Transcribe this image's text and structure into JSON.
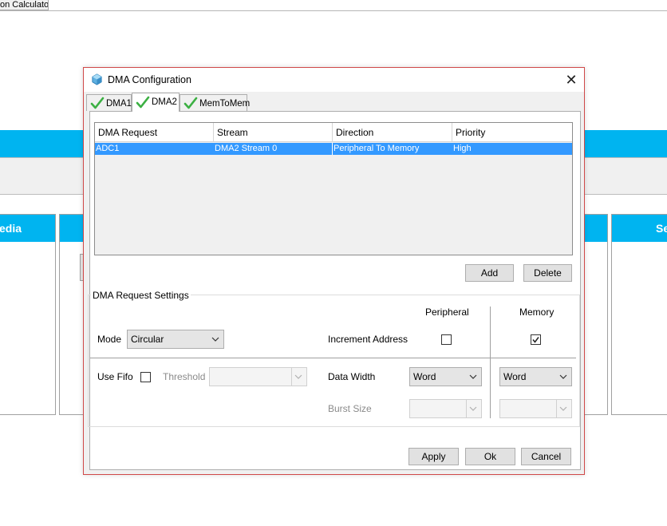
{
  "background": {
    "tab_label": "on Calculator",
    "panel_left_header": "edia",
    "panel_right_header": "Se"
  },
  "dialog": {
    "title": "DMA Configuration",
    "close_symbol": "✕",
    "tabs": [
      {
        "label": "DMA1",
        "active": false
      },
      {
        "label": "DMA2",
        "active": true
      },
      {
        "label": "MemToMem",
        "active": false
      }
    ],
    "table": {
      "columns": [
        "DMA Request",
        "Stream",
        "Direction",
        "Priority"
      ],
      "rows": [
        {
          "request": "ADC1",
          "stream": "DMA2 Stream 0",
          "direction": "Peripheral To Memory",
          "priority": "High",
          "selected": true
        }
      ]
    },
    "buttons": {
      "add": "Add",
      "delete": "Delete",
      "apply": "Apply",
      "ok": "Ok",
      "cancel": "Cancel"
    },
    "settings": {
      "group_title": "DMA Request Settings",
      "col_peripheral": "Peripheral",
      "col_memory": "Memory",
      "mode_label": "Mode",
      "mode_value": "Circular",
      "increment_label": "Increment Address",
      "increment_peripheral": false,
      "increment_memory": true,
      "use_fifo_label": "Use Fifo",
      "use_fifo": false,
      "threshold_label": "Threshold",
      "threshold_value": "",
      "data_width_label": "Data Width",
      "data_width_peripheral": "Word",
      "data_width_memory": "Word",
      "burst_size_label": "Burst Size",
      "burst_size_peripheral": "",
      "burst_size_memory": ""
    },
    "colors": {
      "selection": "#3399ff",
      "border": "#d04848",
      "check": "#3cb043"
    }
  }
}
